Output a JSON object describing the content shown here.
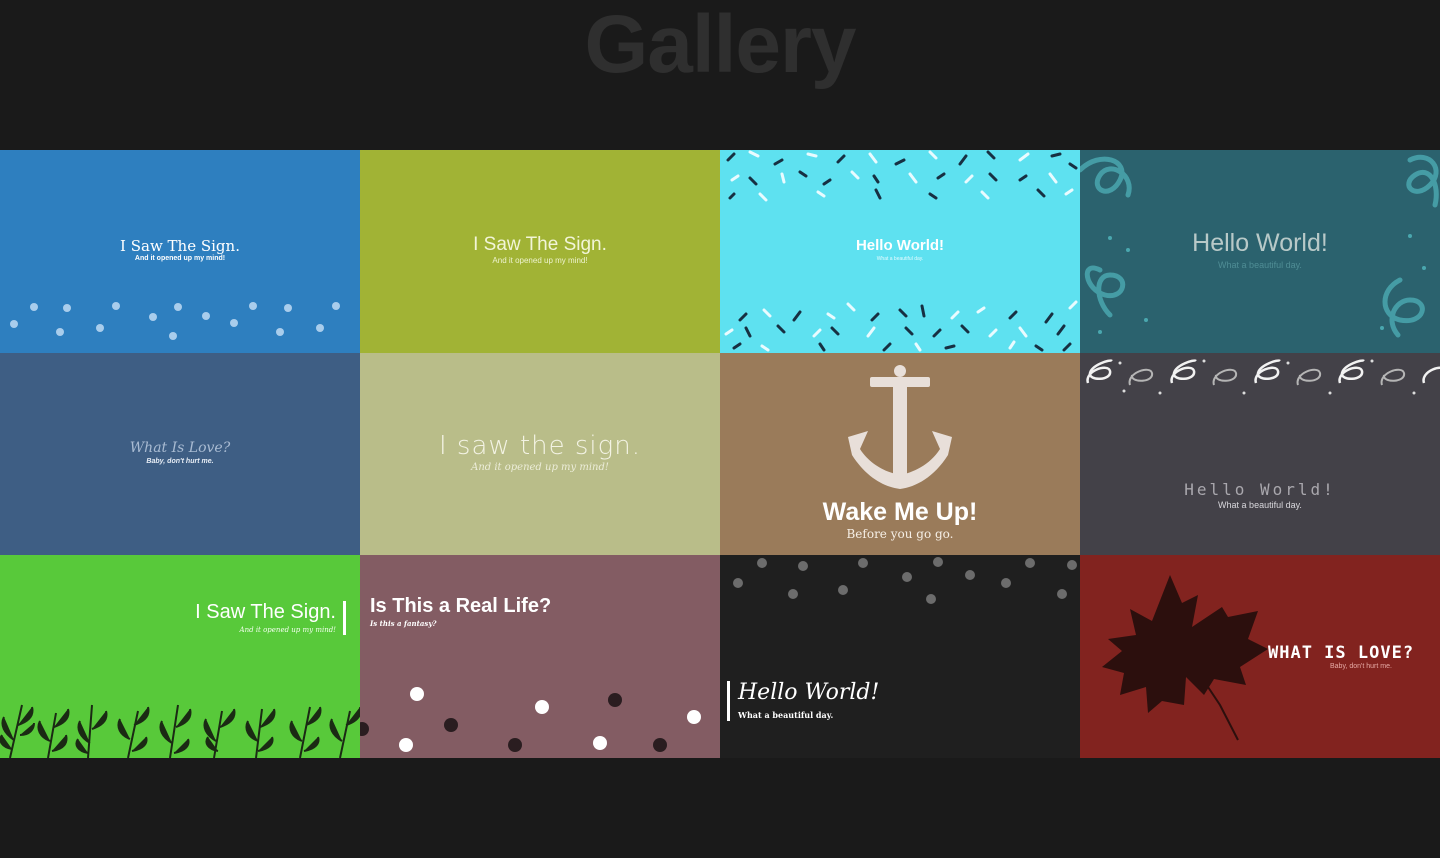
{
  "page": {
    "title": "Gallery"
  },
  "cards": [
    {
      "title": "I Saw The Sign.",
      "subtitle": "And it opened up my mind!",
      "bg": "#2e7fbf"
    },
    {
      "title": "I Saw The Sign.",
      "subtitle": "And it opened up my mind!",
      "bg": "#a1b335"
    },
    {
      "title": "Hello World!",
      "subtitle": "What a beautiful day.",
      "bg": "#5ee1f0"
    },
    {
      "title": "Hello World!",
      "subtitle": "What a beautiful day.",
      "bg": "#2b626e"
    },
    {
      "title": "What Is Love?",
      "subtitle": "Baby, don't hurt me.",
      "bg": "#3e5e84"
    },
    {
      "title": "I saw the sign.",
      "subtitle": "And it opened up my mind!",
      "bg": "#b9bd89"
    },
    {
      "title": "Wake Me Up!",
      "subtitle": "Before you go go.",
      "bg": "#9a7b5a"
    },
    {
      "title": "Hello World!",
      "subtitle": "What a beautiful day.",
      "bg": "#434148"
    },
    {
      "title": "I Saw The Sign.",
      "subtitle": "And it opened up my mind!",
      "bg": "#58c93a"
    },
    {
      "title": "Is This a Real Life?",
      "subtitle": "Is this a fantasy?",
      "bg": "#835c63"
    },
    {
      "title": "Hello World!",
      "subtitle": "What a beautiful day.",
      "bg": "#1f1f1f"
    },
    {
      "title": "WHAT IS LOVE?",
      "subtitle": "Baby, don't hurt me.",
      "bg": "#82231f"
    }
  ]
}
